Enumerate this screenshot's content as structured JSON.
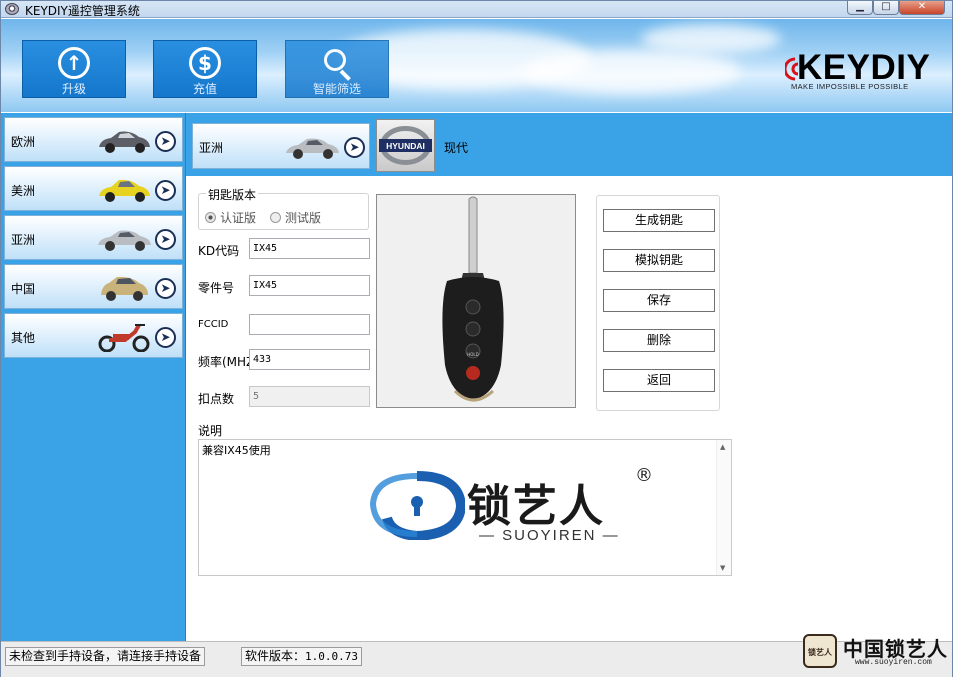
{
  "window": {
    "title": "KEYDIY遥控管理系统",
    "controls": {
      "minimize": "▁",
      "maximize": "□",
      "close": "✕"
    }
  },
  "toolbar": {
    "upgrade": "升级",
    "recharge": "充值",
    "smart_filter": "智能筛选"
  },
  "brand": {
    "name": "KEYDIY",
    "slogan": "MAKE IMPOSSIBLE POSSIBLE"
  },
  "sidebar": {
    "items": [
      {
        "label": "欧洲",
        "icon": "car-icon"
      },
      {
        "label": "美洲",
        "icon": "car-icon"
      },
      {
        "label": "亚洲",
        "icon": "car-icon"
      },
      {
        "label": "中国",
        "icon": "car-icon"
      },
      {
        "label": "其他",
        "icon": "scooter-icon"
      }
    ]
  },
  "region": {
    "selected": "亚洲",
    "make_logo": "HYUNDAI",
    "make_name": "现代"
  },
  "form": {
    "version_legend": "钥匙版本",
    "radio_certified": "认证版",
    "radio_test": "测试版",
    "kd_code_label": "KD代码",
    "kd_code": "IX45",
    "part_no_label": "零件号",
    "part_no": "IX45",
    "fccid_label": "FCCID",
    "fccid": "",
    "freq_label": "频率(MHZ",
    "freq": "433",
    "points_label": "扣点数",
    "points": "5"
  },
  "remote_buttons": [
    "HOLD"
  ],
  "actions": {
    "generate": "生成钥匙",
    "simulate": "模拟钥匙",
    "save": "保存",
    "delete": "删除",
    "back": "返回"
  },
  "description": {
    "label": "说明",
    "text": "兼容IX45使用"
  },
  "suoyiren_logo": {
    "cn": "锁艺人",
    "en": "— SUOYIREN —",
    "reg": "®"
  },
  "status": {
    "device": "未检查到手持设备，请连接手持设备",
    "version_label": "软件版本：",
    "version": "1.0.0.73"
  },
  "watermark": {
    "cn": "中国锁艺人",
    "seal": "锁艺人",
    "url": "www.suoyiren.com"
  },
  "colors": {
    "accent": "#3aa2e6",
    "tool_blue": "#1c82d4",
    "close_red": "#c8442a"
  }
}
